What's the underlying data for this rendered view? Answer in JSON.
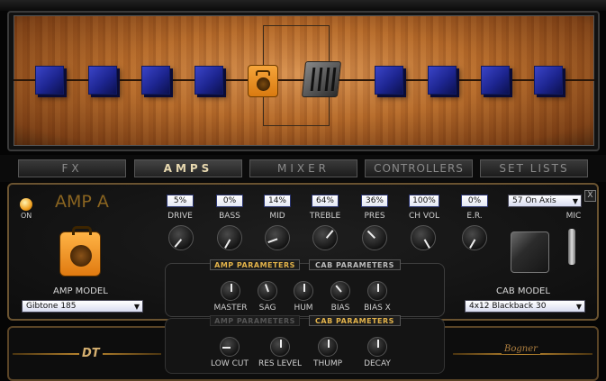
{
  "tabs": [
    "FX",
    "AMPS",
    "MIXER",
    "CONTROLLERS",
    "SET LISTS"
  ],
  "active_tab": "AMPS",
  "amp": {
    "title": "AMP A",
    "power_label": "ON",
    "model_label": "AMP MODEL",
    "model_value": "Gibtone 185"
  },
  "controls": [
    {
      "label": "DRIVE",
      "value": "5%"
    },
    {
      "label": "BASS",
      "value": "0%"
    },
    {
      "label": "MID",
      "value": "14%"
    },
    {
      "label": "TREBLE",
      "value": "64%"
    },
    {
      "label": "PRES",
      "value": "36%"
    },
    {
      "label": "CH VOL",
      "value": "100%"
    },
    {
      "label": "E.R.",
      "value": "0%"
    }
  ],
  "mic": {
    "label": "MIC",
    "value": "57 On Axis"
  },
  "param_tabs": {
    "amp": "AMP PARAMETERS",
    "cab": "CAB PARAMETERS"
  },
  "amp_params": [
    "MASTER",
    "SAG",
    "HUM",
    "BIAS",
    "BIAS X"
  ],
  "cab_params": [
    "LOW CUT",
    "RES LEVEL",
    "THUMP",
    "DECAY"
  ],
  "cab": {
    "label": "CAB MODEL",
    "value": "4x12 Blackback 30"
  },
  "close_label": "X",
  "logos": {
    "left": "DT",
    "right": "Bogner"
  },
  "colors": {
    "accent": "#e3b34a",
    "amp_orange": "#f09a2a",
    "fx_blue": "#2a32b0",
    "panel_gold": "#6a5330"
  },
  "icons": [
    "fx-block-icon",
    "amp-icon",
    "mixer-icon",
    "power-icon",
    "cab-icon",
    "mic-icon",
    "chevron-down-icon",
    "close-icon"
  ]
}
